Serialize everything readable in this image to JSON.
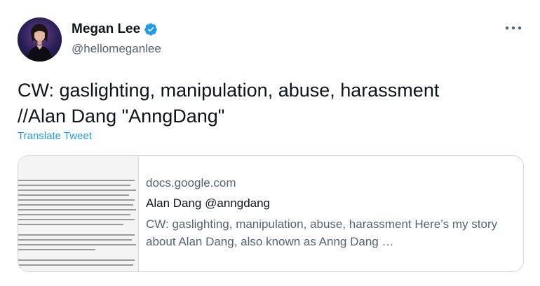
{
  "author": {
    "name": "Megan Lee",
    "handle": "@hellomeganlee",
    "verified": true
  },
  "tweet": {
    "text_lines": [
      "CW: gaslighting, manipulation, abuse, harassment",
      "//Alan Dang \"AnngDang\""
    ],
    "translate_label": "Translate Tweet"
  },
  "link_card": {
    "domain": "docs.google.com",
    "title": "Alan Dang @anngdang",
    "description": "CW: gaslighting, manipulation, abuse, harassment Here’s my story about Alan Dang, also known as Anng Dang …"
  },
  "icons": {
    "verified": "verified-badge-icon",
    "more": "more-options-icon"
  },
  "colors": {
    "accent": "#1d9bf0",
    "text_primary": "#0f1419",
    "text_secondary": "#536471",
    "border": "#cfd9de"
  }
}
